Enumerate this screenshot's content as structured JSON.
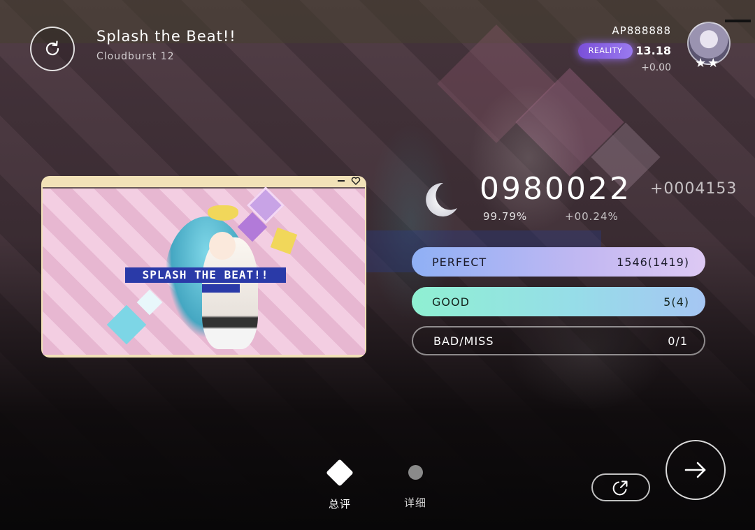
{
  "song": {
    "title": "Splash the Beat!!",
    "difficulty": "Cloudburst 12"
  },
  "jacket": {
    "logo_text": "SPLASH THE BEAT!!"
  },
  "player": {
    "name": "AP888888",
    "badge": "REALITY",
    "rating": "13.18",
    "rating_delta": "+0.00",
    "stars": "★★"
  },
  "result": {
    "rank_icon": "crescent-moon-icon",
    "score": "0980022",
    "score_delta": "+0004153",
    "accuracy": "99.79%",
    "accuracy_delta": "+00.24%"
  },
  "judgements": [
    {
      "label": "PERFECT",
      "value": "1546(1419)"
    },
    {
      "label": "GOOD",
      "value": "5(4)"
    },
    {
      "label": "BAD/MISS",
      "value": "0/1"
    }
  ],
  "tabs": [
    {
      "label": "总评",
      "icon": "diamond-icon",
      "active": true
    },
    {
      "label": "详细",
      "icon": "dot-icon",
      "active": false
    }
  ],
  "icons": {
    "retry": "retry-icon",
    "share": "share-icon",
    "next": "arrow-right-icon",
    "menu": "menu-icon"
  },
  "colors": {
    "perfect_start": "#8fb0f5",
    "perfect_end": "#ddc9f3",
    "good_start": "#8ff0d2",
    "good_end": "#a6c6f3",
    "reality_badge": "#7a4fd8"
  }
}
